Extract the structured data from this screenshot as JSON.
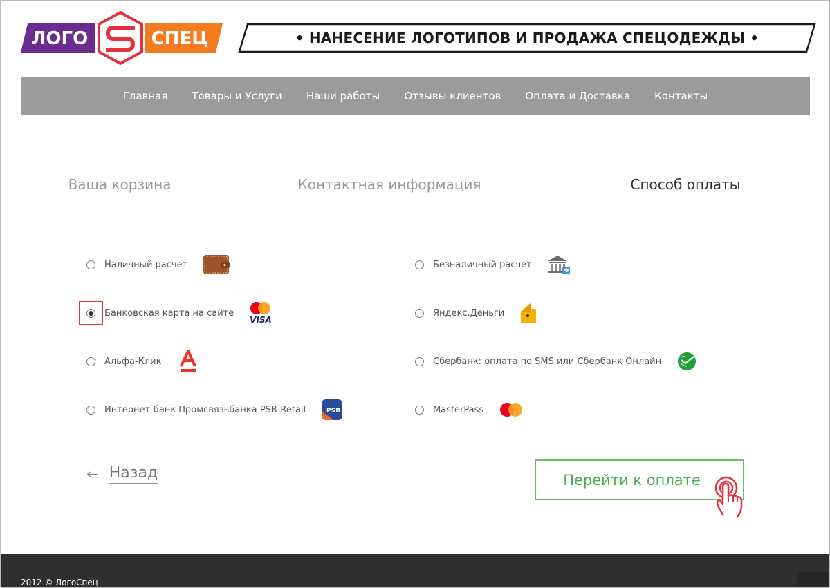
{
  "brand": {
    "logo_left": "ЛОГО",
    "logo_right": "СПЕЦ",
    "slogan": "• НАНЕСЕНИЕ ЛОГОТИПОВ И ПРОДАЖА СПЕЦОДЕЖДЫ •",
    "colors": {
      "purple": "#6b2c8f",
      "orange": "#f47b20",
      "red": "#e8303a"
    }
  },
  "nav": {
    "items": [
      "Главная",
      "Товары и Услуги",
      "Наши работы",
      "Отзывы клиентов",
      "Оплата и Доставка",
      "Контакты"
    ]
  },
  "steps": [
    {
      "label": "Ваша корзина",
      "active": false
    },
    {
      "label": "Контактная информация",
      "active": false
    },
    {
      "label": "Способ оплаты",
      "active": true
    }
  ],
  "payment_methods": [
    {
      "label": "Наличный расчет",
      "icon": "wallet-icon",
      "selected": false
    },
    {
      "label": "Безналичный расчет",
      "icon": "bank-icon",
      "selected": false
    },
    {
      "label": "Банковская карта на сайте",
      "icon": "mastercard-visa-icon",
      "selected": true
    },
    {
      "label": "Яндекс.Деньги",
      "icon": "yandex-money-icon",
      "selected": false
    },
    {
      "label": "Альфа-Клик",
      "icon": "alfa-bank-icon",
      "selected": false
    },
    {
      "label": "Сбербанк: оплата по SMS или Сбербанк Онлайн",
      "icon": "sberbank-icon",
      "selected": false
    },
    {
      "label": "Интернет-банк Промсвязьбанка PSB-Retail",
      "icon": "psb-icon",
      "selected": false
    },
    {
      "label": "MasterPass",
      "icon": "masterpass-icon",
      "selected": false
    }
  ],
  "visa_text": "VISA",
  "psb_text": "PSB",
  "back": {
    "arrow": "←",
    "label": "Назад"
  },
  "proceed_label": "Перейти к оплате",
  "accent_green": "#4caf50",
  "footer": {
    "copyright": "2012 © ЛогоСпец"
  }
}
